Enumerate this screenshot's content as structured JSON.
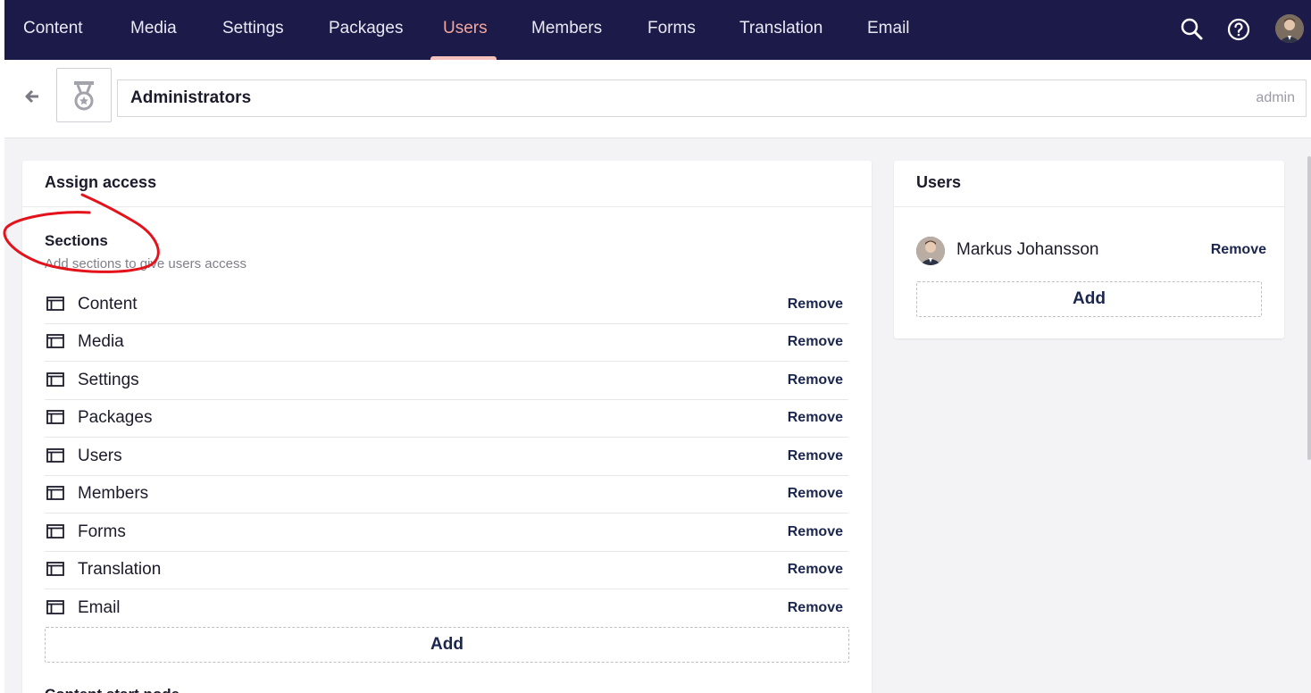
{
  "nav": {
    "items": [
      {
        "label": "Content",
        "active": false
      },
      {
        "label": "Media",
        "active": false
      },
      {
        "label": "Settings",
        "active": false
      },
      {
        "label": "Packages",
        "active": false
      },
      {
        "label": "Users",
        "active": true
      },
      {
        "label": "Members",
        "active": false
      },
      {
        "label": "Forms",
        "active": false
      },
      {
        "label": "Translation",
        "active": false
      },
      {
        "label": "Email",
        "active": false
      }
    ],
    "icons": [
      "search-icon",
      "help-icon",
      "user-avatar"
    ]
  },
  "header": {
    "group_icon": "medal-icon",
    "name": "Administrators",
    "alias": "admin"
  },
  "assign_access": {
    "title": "Assign access",
    "sections": {
      "heading": "Sections",
      "description": "Add sections to give users access",
      "items": [
        {
          "label": "Content",
          "remove_label": "Remove"
        },
        {
          "label": "Media",
          "remove_label": "Remove"
        },
        {
          "label": "Settings",
          "remove_label": "Remove"
        },
        {
          "label": "Packages",
          "remove_label": "Remove"
        },
        {
          "label": "Users",
          "remove_label": "Remove"
        },
        {
          "label": "Members",
          "remove_label": "Remove"
        },
        {
          "label": "Forms",
          "remove_label": "Remove"
        },
        {
          "label": "Translation",
          "remove_label": "Remove"
        },
        {
          "label": "Email",
          "remove_label": "Remove"
        }
      ],
      "add_label": "Add"
    },
    "next_heading": "Content start node"
  },
  "users_panel": {
    "title": "Users",
    "users": [
      {
        "name": "Markus Johansson",
        "remove_label": "Remove"
      }
    ],
    "add_label": "Add"
  },
  "colors": {
    "topbar": "#1b1a49",
    "active_nav": "#f5a59a",
    "annotation": "#e3121b"
  }
}
